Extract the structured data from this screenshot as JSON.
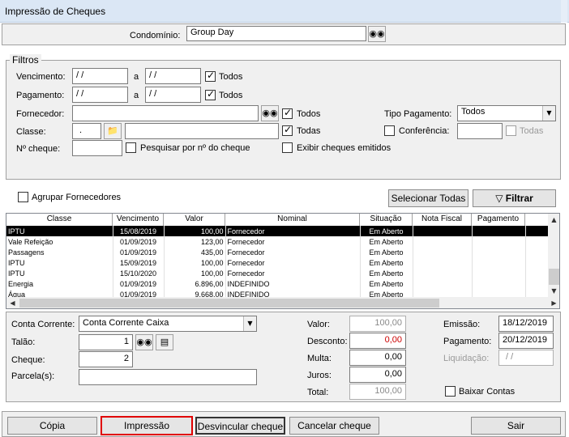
{
  "window": {
    "title": "Impressão de Cheques"
  },
  "condominio": {
    "label": "Condomínio:",
    "value": "Group Day"
  },
  "filtros": {
    "legend": "Filtros",
    "vencimento": {
      "label": "Vencimento:",
      "from": "/ /",
      "sep": "a",
      "to": "/ /",
      "todos_label": "Todos",
      "todos_checked": true
    },
    "pagamento": {
      "label": "Pagamento:",
      "from": "/ /",
      "sep": "a",
      "to": "/ /",
      "todos_label": "Todos",
      "todos_checked": true
    },
    "fornecedor": {
      "label": "Fornecedor:",
      "value": "",
      "todos_label": "Todos",
      "todos_checked": true
    },
    "tipo_pagamento": {
      "label": "Tipo Pagamento:",
      "value": "Todos"
    },
    "classe": {
      "label": "Classe:",
      "code": ".",
      "name": "",
      "todas_label": "Todas",
      "todas_checked": true
    },
    "conferencia": {
      "label": "Conferência:",
      "value": "",
      "todas_label": "Todas",
      "checked": false
    },
    "numero_cheque": {
      "label": "Nº cheque:",
      "value": "",
      "pesquisar_label": "Pesquisar por nº do cheque",
      "pesquisar_checked": false
    },
    "exibir_emitidos": {
      "label": "Exibir cheques emitidos",
      "checked": false
    }
  },
  "grouping": {
    "agrupar_label": "Agrupar Fornecedores",
    "selecionar_label": "Selecionar Todas",
    "filtrar_label": "Filtrar"
  },
  "grid": {
    "columns": [
      "Classe",
      "Vencimento",
      "Valor",
      "Nominal",
      "Situação",
      "Nota Fiscal",
      "Pagamento"
    ],
    "rows": [
      [
        "IPTU",
        "15/08/2019",
        "100,00",
        "Fornecedor",
        "Em Aberto",
        "",
        ""
      ],
      [
        "Vale Refeição",
        "01/09/2019",
        "123,00",
        "Fornecedor",
        "Em Aberto",
        "",
        ""
      ],
      [
        "Passagens",
        "01/09/2019",
        "435,00",
        "Fornecedor",
        "Em Aberto",
        "",
        ""
      ],
      [
        "IPTU",
        "15/09/2019",
        "100,00",
        "Fornecedor",
        "Em Aberto",
        "",
        ""
      ],
      [
        "IPTU",
        "15/10/2020",
        "100,00",
        "Fornecedor",
        "Em Aberto",
        "",
        ""
      ],
      [
        "Energia",
        "01/09/2019",
        "6.896,00",
        "INDEFINIDO",
        "Em Aberto",
        "",
        ""
      ],
      [
        "Água",
        "01/09/2019",
        "9.668,00",
        "INDEFINIDO",
        "Em Aberto",
        "",
        ""
      ]
    ]
  },
  "bottom": {
    "conta_corrente": {
      "label": "Conta Corrente:",
      "value": "Conta Corrente Caixa"
    },
    "talao": {
      "label": "Talão:",
      "value": "1"
    },
    "cheque": {
      "label": "Cheque:",
      "value": "2"
    },
    "parcelas": {
      "label": "Parcela(s):",
      "value": ""
    },
    "valor": {
      "label": "Valor:",
      "value": "100,00"
    },
    "desconto": {
      "label": "Desconto:",
      "value": "0,00"
    },
    "multa": {
      "label": "Multa:",
      "value": "0,00"
    },
    "juros": {
      "label": "Juros:",
      "value": "0,00"
    },
    "total": {
      "label": "Total:",
      "value": "100,00"
    },
    "emissao": {
      "label": "Emissão:",
      "value": "18/12/2019"
    },
    "pagamento": {
      "label": "Pagamento:",
      "value": "20/12/2019"
    },
    "liquidacao": {
      "label": "Liquidação:",
      "value": "/ /"
    },
    "baixar_contas": {
      "label": "Baixar Contas",
      "checked": false
    }
  },
  "actions": {
    "copia": "Cópia",
    "impressao": "Impressão",
    "desvincular": "Desvincular cheque",
    "cancelar": "Cancelar cheque",
    "sair": "Sair"
  },
  "colors": {
    "highlight_border": "#e00000",
    "selected_row_bg": "#000000",
    "negative_value": "#cc0000"
  }
}
